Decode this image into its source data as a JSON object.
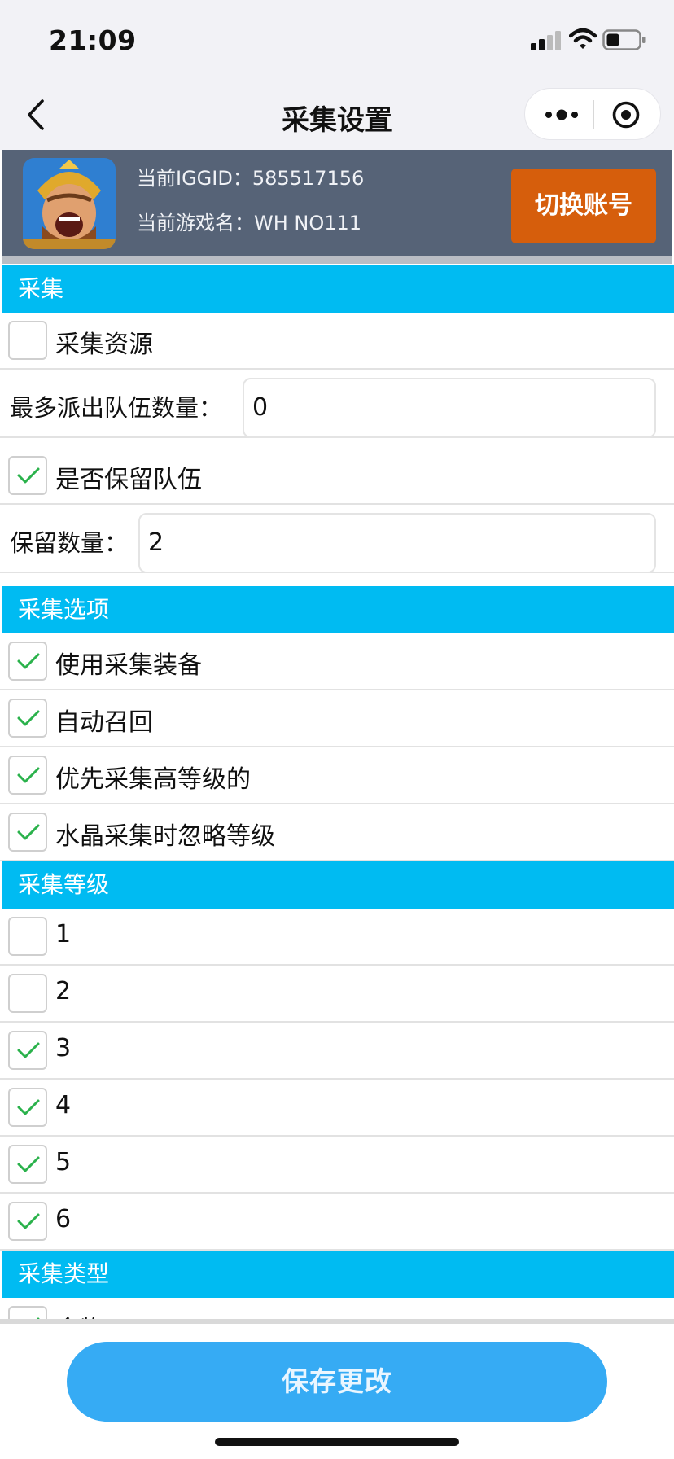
{
  "status_bar": {
    "time": "21:09",
    "icons": [
      "signal-icon",
      "wifi-icon",
      "battery-icon"
    ]
  },
  "nav": {
    "title": "采集设置",
    "back_icon": "chevron-left-icon",
    "more_icon": "more-dots-icon",
    "target_icon": "target-icon"
  },
  "account": {
    "iggid_line": "当前IGGID：585517156",
    "game_name_line": "当前游戏名：WH NO111",
    "switch_label": "切换账号"
  },
  "sections": {
    "collect": "采集",
    "options": "采集选项",
    "levels": "采集等级",
    "types": "采集类型"
  },
  "collect": {
    "resources": {
      "label": "采集资源",
      "checked": false
    },
    "max_troops": {
      "label": "最多派出队伍数量：",
      "value": "0"
    },
    "keep_troops": {
      "label": "是否保留队伍",
      "checked": true
    },
    "keep_count": {
      "label": "保留数量：",
      "value": "2"
    }
  },
  "options": [
    {
      "label": "使用采集装备",
      "checked": true
    },
    {
      "label": "自动召回",
      "checked": true
    },
    {
      "label": "优先采集高等级的",
      "checked": true
    },
    {
      "label": "水晶采集时忽略等级",
      "checked": true
    }
  ],
  "levels": [
    {
      "label": "1",
      "checked": false
    },
    {
      "label": "2",
      "checked": false
    },
    {
      "label": "3",
      "checked": true
    },
    {
      "label": "4",
      "checked": true
    },
    {
      "label": "5",
      "checked": true
    },
    {
      "label": "6",
      "checked": true
    }
  ],
  "types": [
    {
      "label": "食物",
      "checked": true
    }
  ],
  "save_label": "保存更改",
  "colors": {
    "section": "#00bbf2",
    "account_bg": "#566377",
    "switch_button": "#d65e0c",
    "save_button": "#36abf4",
    "check": "#2bb24c"
  }
}
